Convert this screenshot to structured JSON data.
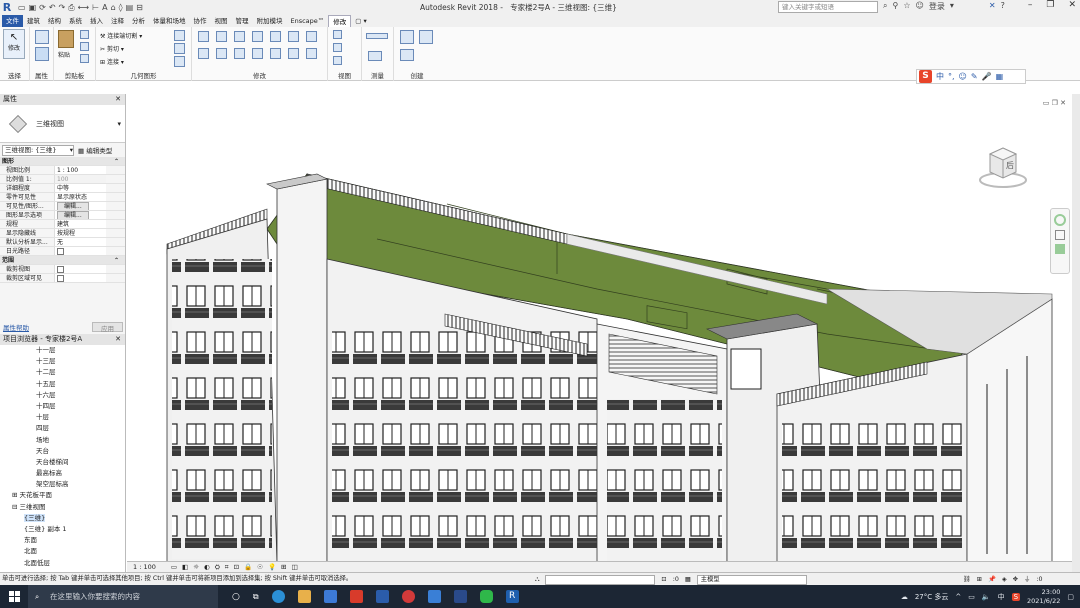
{
  "title": {
    "app_title": "Autodesk Revit 2018 -",
    "doc_title": "专家楼2号A - 三维视图: {三维}",
    "search_placeholder": "键入关键字或短语",
    "login": "登录",
    "help": "?"
  },
  "tabs": [
    "文件",
    "建筑",
    "结构",
    "系统",
    "插入",
    "注释",
    "分析",
    "体量和场地",
    "协作",
    "视图",
    "管理",
    "附加模块",
    "Enscape™",
    "修改"
  ],
  "active_tab": "修改",
  "ribbon": {
    "modify_label": "修改",
    "paste_label": "粘贴",
    "clip": {
      "cut": "剪切",
      "join": "连接",
      "connect_cut": "连接端切割"
    },
    "panels": {
      "select": "选择",
      "properties": "属性",
      "clipboard": "剪贴板",
      "geometry": "几何图形",
      "modify": "修改",
      "view": "视图",
      "measure": "测量",
      "create": "创建"
    }
  },
  "ime": {
    "chars": [
      "中",
      "°,",
      "☺",
      "✎",
      "🎤",
      "▦"
    ]
  },
  "properties": {
    "header": "属性",
    "type_name": "三维视图",
    "selector": "三维视图: {三维}",
    "edit_type": "编辑类型",
    "rows": [
      {
        "cat": "图形"
      },
      {
        "k": "视图比例",
        "v": "1 : 100"
      },
      {
        "k": "比例值 1:",
        "v": "100",
        "dis": true
      },
      {
        "k": "详细程度",
        "v": "中等"
      },
      {
        "k": "零件可见性",
        "v": "显示原状态"
      },
      {
        "k": "可见性/图形...",
        "btn": "编辑..."
      },
      {
        "k": "图形显示选项",
        "btn": "编辑..."
      },
      {
        "k": "规程",
        "v": "建筑"
      },
      {
        "k": "显示隐藏线",
        "v": "按规程"
      },
      {
        "k": "默认分析显示...",
        "v": "无"
      },
      {
        "k": "日光路径",
        "cb": true
      },
      {
        "cat": "范围"
      },
      {
        "k": "裁剪视图",
        "cb": true
      },
      {
        "k": "裁剪区域可见",
        "cb": true
      }
    ],
    "help_link": "属性帮助",
    "apply": "应用"
  },
  "browser": {
    "header": "项目浏览器 - 专家楼2号A",
    "items": [
      {
        "t": "十一层",
        "d": 3
      },
      {
        "t": "十三层",
        "d": 3
      },
      {
        "t": "十二层",
        "d": 3
      },
      {
        "t": "十五层",
        "d": 3
      },
      {
        "t": "十六层",
        "d": 3
      },
      {
        "t": "十四层",
        "d": 3
      },
      {
        "t": "十层",
        "d": 3
      },
      {
        "t": "四层",
        "d": 3
      },
      {
        "t": "场地",
        "d": 3
      },
      {
        "t": "天台",
        "d": 3
      },
      {
        "t": "天台楼梯间",
        "d": 3
      },
      {
        "t": "最高标高",
        "d": 3
      },
      {
        "t": "架空层标高",
        "d": 3
      },
      {
        "t": "天花板平面",
        "d": 1,
        "tog": "⊞"
      },
      {
        "t": "三维视图",
        "d": 1,
        "tog": "⊟"
      },
      {
        "t": "{三维}",
        "d": 2,
        "sel": true
      },
      {
        "t": "{三维} 副本 1",
        "d": 2
      },
      {
        "t": "东面",
        "d": 2
      },
      {
        "t": "北面",
        "d": 2
      },
      {
        "t": "北面低层",
        "d": 2
      }
    ]
  },
  "viewcube": {
    "face": "后"
  },
  "viewbar": {
    "scale": "1 : 100"
  },
  "status": {
    "hint": "单击可进行选择; 按 Tab 键并单击可选择其他项目; 按 Ctrl 键并单击可将新项目添加到选择集; 按 Shift 键并单击可取消选择。",
    "zero": ":0",
    "model": "主模型"
  },
  "taskbar": {
    "search_placeholder": "在这里输入你要搜索的内容",
    "weather": "27°C 多云",
    "time": "23:00",
    "date": "2021/6/22",
    "ime": "中"
  },
  "colors": {
    "roof": "#6d8a3c",
    "wall": "#efefef",
    "dark": "#2a2a2a",
    "accent": "#2a5aa8"
  }
}
